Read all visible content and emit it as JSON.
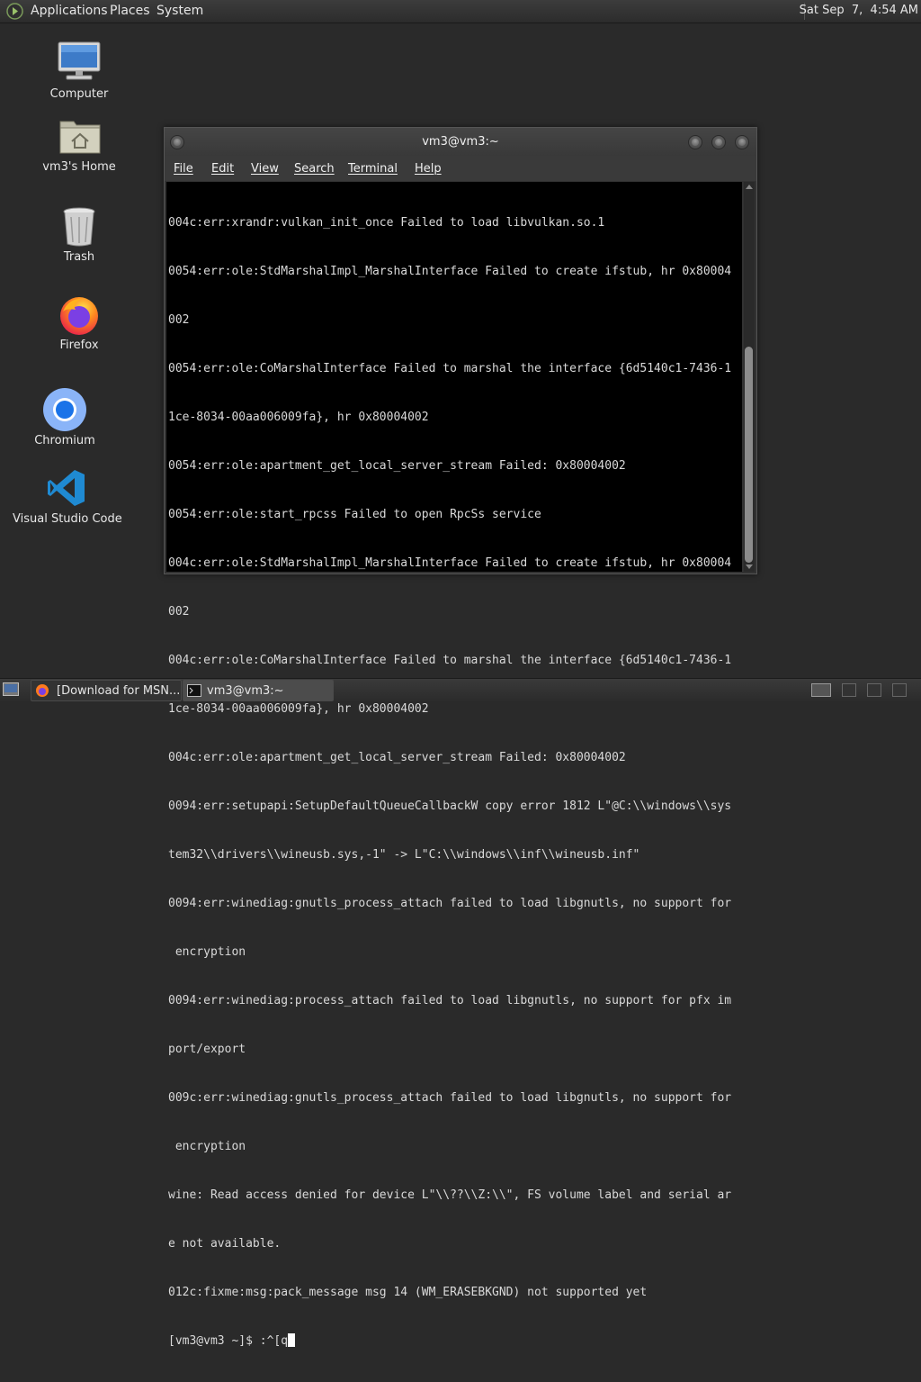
{
  "top_panel": {
    "menus": [
      "Applications",
      "Places",
      "System"
    ],
    "clock": "Sat Sep  7,  4:54 AM"
  },
  "desktop": {
    "icons": [
      {
        "label": "Computer",
        "icon": "computer-icon"
      },
      {
        "label": "vm3's Home",
        "icon": "home-folder-icon"
      },
      {
        "label": "Trash",
        "icon": "trash-icon"
      },
      {
        "label": "Firefox",
        "icon": "firefox-icon"
      },
      {
        "label": "Chromium",
        "icon": "chromium-icon"
      },
      {
        "label": "Visual Studio Code",
        "icon": "vscode-icon"
      }
    ]
  },
  "terminal": {
    "title": "vm3@vm3:~",
    "menu": [
      "File",
      "Edit",
      "View",
      "Search",
      "Terminal",
      "Help"
    ],
    "lines": [
      "004c:err:xrandr:vulkan_init_once Failed to load libvulkan.so.1",
      "0054:err:ole:StdMarshalImpl_MarshalInterface Failed to create ifstub, hr 0x80004",
      "002",
      "0054:err:ole:CoMarshalInterface Failed to marshal the interface {6d5140c1-7436-1",
      "1ce-8034-00aa006009fa}, hr 0x80004002",
      "0054:err:ole:apartment_get_local_server_stream Failed: 0x80004002",
      "0054:err:ole:start_rpcss Failed to open RpcSs service",
      "004c:err:ole:StdMarshalImpl_MarshalInterface Failed to create ifstub, hr 0x80004",
      "002",
      "004c:err:ole:CoMarshalInterface Failed to marshal the interface {6d5140c1-7436-1",
      "1ce-8034-00aa006009fa}, hr 0x80004002",
      "004c:err:ole:apartment_get_local_server_stream Failed: 0x80004002",
      "0094:err:setupapi:SetupDefaultQueueCallbackW copy error 1812 L\"@C:\\\\windows\\\\sys",
      "tem32\\\\drivers\\\\wineusb.sys,-1\" -> L\"C:\\\\windows\\\\inf\\\\wineusb.inf\"",
      "0094:err:winediag:gnutls_process_attach failed to load libgnutls, no support for",
      " encryption",
      "0094:err:winediag:process_attach failed to load libgnutls, no support for pfx im",
      "port/export",
      "009c:err:winediag:gnutls_process_attach failed to load libgnutls, no support for",
      " encryption",
      "wine: Read access denied for device L\"\\\\??\\\\Z:\\\\\", FS volume label and serial ar",
      "e not available.",
      "012c:fixme:msg:pack_message msg 14 (WM_ERASEBKGND) not supported yet"
    ],
    "prompt": "[vm3@vm3 ~]$ :^[q"
  },
  "taskbar": {
    "tasks": [
      {
        "label": "[Download for MSN...",
        "icon": "firefox-icon"
      },
      {
        "label": "vm3@vm3:~",
        "icon": "terminal-icon"
      }
    ]
  }
}
